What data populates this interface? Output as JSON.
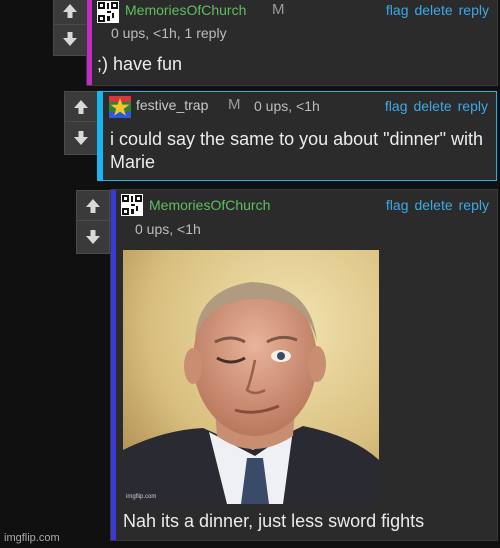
{
  "colors": {
    "green_user": "#5fbf5f",
    "link_blue": "#3ca9e6",
    "stripe_magenta": "#c42bc4",
    "stripe_cyan": "#17b6f0",
    "stripe_blue": "#3a3ad8"
  },
  "comments": [
    {
      "username": "MemoriesOfChurch",
      "mod_badge": "M",
      "meta": "0 ups, <1h, 1 reply",
      "text": ";) have fun",
      "avatar_icon": "qr-avatar-icon",
      "actions": {
        "flag": "flag",
        "delete": "delete",
        "reply": "reply"
      }
    },
    {
      "username": "festive_trap",
      "mod_badge": "M",
      "meta": "0 ups, <1h",
      "text": "i could say the same to you about \"dinner\" with Marie",
      "avatar_icon": "star-avatar-icon",
      "actions": {
        "flag": "flag",
        "delete": "delete",
        "reply": "reply"
      }
    },
    {
      "username": "MemoriesOfChurch",
      "meta": "0 ups, <1h",
      "image_watermark": "imgflip.com",
      "text": "Nah its a dinner, just less sword fights",
      "avatar_icon": "qr-avatar-icon",
      "actions": {
        "flag": "flag",
        "delete": "delete",
        "reply": "reply"
      }
    }
  ],
  "footer_watermark": "imgflip.com"
}
